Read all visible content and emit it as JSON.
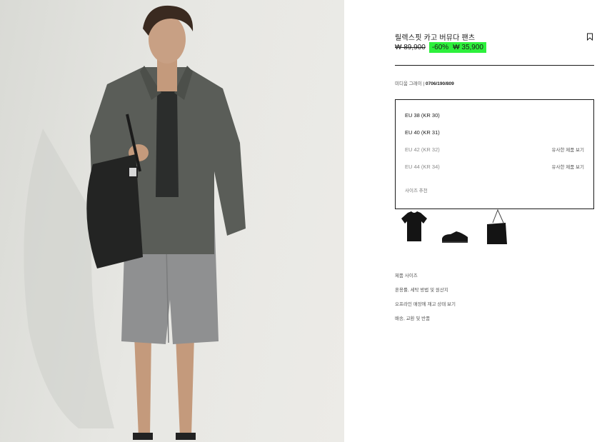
{
  "product": {
    "title": "릴렉스핏 카고 버뮤다 팬츠",
    "price_original": "₩ 89,900",
    "discount": "-60%",
    "price_sale": "₩ 35,900",
    "color_label": "미디움 그레이",
    "color_code": "0706/190/809"
  },
  "sizes": [
    {
      "label": "EU 38 (KR 30)",
      "available": true,
      "note": ""
    },
    {
      "label": "EU 40 (KR 31)",
      "available": true,
      "note": ""
    },
    {
      "label": "EU 42 (KR 32)",
      "available": false,
      "note": "유사한 제품 보기"
    },
    {
      "label": "EU 44 (KR 34)",
      "available": false,
      "note": "유사한 제품 보기"
    }
  ],
  "size_guide": "사이즈 추천",
  "related_items": [
    "black-tshirt",
    "black-derby-shoes",
    "black-tote-bag"
  ],
  "info_links": [
    "제품 사이즈",
    "혼용률, 세탁 방법 및 원산지",
    "오프라인 매장에 재고 상태 보기",
    "배송, 교환 및 반품"
  ],
  "colors": {
    "discount_highlight": "#2df03c",
    "text": "#1a1a1a",
    "muted": "#8a8a8a"
  }
}
